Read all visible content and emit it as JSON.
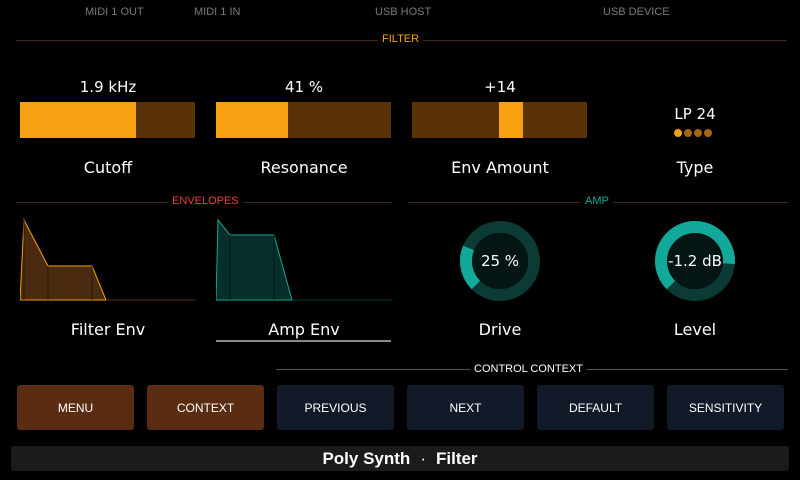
{
  "status": {
    "midi1_out": "MIDI 1 OUT",
    "midi1_in": "MIDI 1 IN",
    "usb_host": "USB HOST",
    "usb_device": "USB DEVICE"
  },
  "sections": {
    "filter": "FILTER",
    "envelopes": "ENVELOPES",
    "amp": "AMP",
    "control_context": "CONTROL CONTEXT"
  },
  "filter": {
    "cutoff": {
      "value": "1.9 kHz",
      "label": "Cutoff",
      "level": 0.66
    },
    "resonance": {
      "value": "41 %",
      "label": "Resonance",
      "level": 0.41
    },
    "env_amount": {
      "value": "+14",
      "label": "Env Amount"
    },
    "type": {
      "value": "LP 24",
      "label": "Type",
      "dots_on": 1,
      "dots_total": 4
    }
  },
  "envelopes": {
    "filter_env": {
      "label": "Filter Env"
    },
    "amp_env": {
      "label": "Amp Env"
    }
  },
  "amp": {
    "drive": {
      "value": "25 %",
      "label": "Drive",
      "level": 0.25
    },
    "level": {
      "value": "-1.2 dB",
      "label": "Level",
      "level": 0.85
    }
  },
  "buttons": {
    "menu": "MENU",
    "context": "CONTEXT",
    "previous": "PREVIOUS",
    "next": "NEXT",
    "default": "DEFAULT",
    "sensitivity": "SENSITIVITY"
  },
  "footer": {
    "device": "Poly Synth",
    "separator": "·",
    "page": "Filter"
  },
  "colors": {
    "accent_orange": "#f7a012",
    "bar_track": "#5a3208",
    "envelopes_red": "#e8433a",
    "amp_teal": "#12a89a",
    "button_dark": "#121a2a",
    "button_brown": "#5a2c12"
  }
}
